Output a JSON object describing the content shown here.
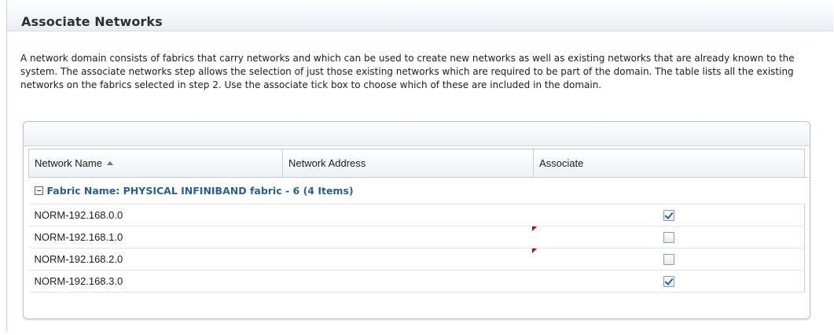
{
  "page": {
    "title": "Associate Networks",
    "description": "A network domain consists of fabrics that carry networks and which can be used to create new networks as well as existing networks that are already known to the system. The associate networks step allows the selection of just those existing networks which are required to be part of the domain. The table lists all the existing networks on the fabrics selected in step 2. Use the associate tick box to choose which of these are included in the domain."
  },
  "table": {
    "columns": [
      "Network Name",
      "Network Address",
      "Associate"
    ],
    "sort_column": "Network Name",
    "sort_direction": "ascending",
    "group_label": "Fabric Name: PHYSICAL INFINIBAND fabric - 6 (4 Items)",
    "rows": [
      {
        "name": "NORM-192.168.0.0",
        "address": "",
        "associate": true,
        "modified": false
      },
      {
        "name": "NORM-192.168.1.0",
        "address": "",
        "associate": false,
        "modified": true
      },
      {
        "name": "NORM-192.168.2.0",
        "address": "",
        "associate": false,
        "modified": true
      },
      {
        "name": "NORM-192.168.3.0",
        "address": "",
        "associate": true,
        "modified": false
      }
    ]
  },
  "colors": {
    "title": "#2c3138",
    "group_text": "#2a5f95",
    "check_mark": "#2f5fa5",
    "modified_marker": "#cc0000"
  }
}
